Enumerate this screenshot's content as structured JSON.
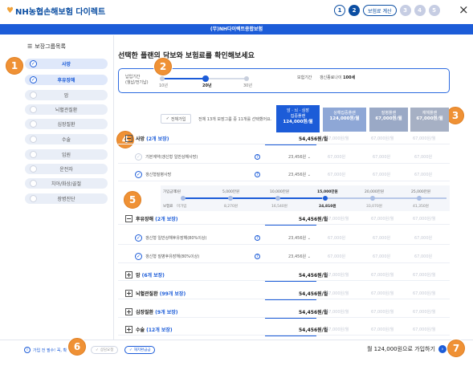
{
  "header": {
    "logo_text": "NH농협손해보험 다이렉트",
    "steps": [
      "1",
      "2",
      "3",
      "4",
      "5"
    ],
    "step_current_label": "보험료 계산",
    "close_symbol": "×",
    "bar_title": "(무)NH다이렉트종합보험"
  },
  "sidebar": {
    "title": "보장그룹목록",
    "items": [
      {
        "label": "사망",
        "checked": true
      },
      {
        "label": "후유장해",
        "checked": true
      },
      {
        "label": "암",
        "checked": false
      },
      {
        "label": "뇌혈관질환",
        "checked": false
      },
      {
        "label": "심장질환",
        "checked": false
      },
      {
        "label": "수술",
        "checked": false
      },
      {
        "label": "입원",
        "checked": false
      },
      {
        "label": "운전자",
        "checked": false
      },
      {
        "label": "치아/화상/골절",
        "checked": false
      },
      {
        "label": "장병진단",
        "checked": false
      }
    ]
  },
  "main": {
    "title": "선택한 플랜의 담보와 보험료를 확인해보세요",
    "period": {
      "label_line1": "납입기간",
      "label_line2": "(월납/전기납)",
      "ticks": [
        "10년",
        "20년",
        "30년"
      ],
      "selected_index": 1,
      "right_label": "보험기간",
      "right_value_prefix": "갱신종료나이 ",
      "right_value_bold": "100세"
    },
    "all_button": "전체가입",
    "select_info": "전체 13개 보장그룹 중 11개를 선택했어요.",
    "plans": [
      {
        "name_line1": "암 · 뇌 · 심장",
        "name_line2": "집중플랜",
        "price": "124,000원/월"
      },
      {
        "name_line1": "상해집중플랜",
        "name_line2": "",
        "price": "124,000원/월"
      },
      {
        "name_line1": "질병플랜",
        "name_line2": "",
        "price": "67,000원/월"
      },
      {
        "name_line1": "재해플랜",
        "name_line2": "",
        "price": "67,000원/월"
      }
    ]
  },
  "sections": {
    "death": {
      "title": "사망 ",
      "count": "(2개 보장)",
      "price": "54,456원/월",
      "others": [
        "67,000원/월",
        "67,000원/월",
        "67,000원/월"
      ]
    },
    "death_sub1": {
      "label": "기본계약(갱신형 일반상해사망)",
      "value": "23,456원",
      "others": [
        "67,000원",
        "67,000원",
        "67,000원"
      ]
    },
    "death_sub2": {
      "label": "갱신형질병사망",
      "value": "23,456원",
      "others": [
        "67,000원",
        "67,000원",
        "67,000원"
      ]
    },
    "slider": {
      "top_label": "가입금액",
      "bot_label": "보험료",
      "tops": [
        "0원",
        "5,000만원",
        "10,000만원",
        "15,000만원",
        "20,000만원",
        "25,000만원"
      ],
      "bots": [
        "미가입",
        "8,270원",
        "16,540원",
        "24,810원",
        "33,070원",
        "41,350원"
      ],
      "selected_index": 3
    },
    "disability": {
      "title": "후유장해 ",
      "count": "(2개 보장)",
      "price": "54,456원/월",
      "others": [
        "67,000원/월",
        "67,000원/월",
        "67,000원/월"
      ]
    },
    "dis_sub1": {
      "label": "갱신형 일반상해후유장해(80%이상)",
      "value": "23,456원",
      "others": [
        "67,000원",
        "67,000원",
        "67,000원"
      ]
    },
    "dis_sub2": {
      "label": "갱신형 질병후유장해(80%이상)",
      "value": "23,456원",
      "others": [
        "67,000원",
        "67,000원",
        "67,000원"
      ]
    },
    "cancer": {
      "title": "암 ",
      "count": "(6개 보장)",
      "price": "54,456원/월",
      "others": [
        "67,000원/월",
        "67,000원/월",
        "67,000원/월"
      ]
    },
    "brain": {
      "title": "뇌혈관질환 ",
      "count": "(99개 보장)",
      "price": "54,456원/월",
      "others": [
        "67,000원/월",
        "67,000원/월",
        "67,000원/월"
      ]
    },
    "heart": {
      "title": "심장질환 ",
      "count": "(9개 보장)",
      "price": "54,456원/월",
      "others": [
        "67,000원/월",
        "67,000원/월",
        "67,000원/월"
      ]
    },
    "surgery": {
      "title": "수술 ",
      "count": "(12개 보장)",
      "price": "54,456원/월",
      "others": [
        "67,000원/월",
        "67,000원/월",
        "67,000원/월"
      ]
    }
  },
  "footer": {
    "left_text": "가입 전 필수! 꼭, 확",
    "btn1": "상담요청",
    "btn2": "해지환급금",
    "right_text": "월 124,000원으로 가입하기"
  },
  "badges": [
    "1",
    "2",
    "3",
    "4",
    "5",
    "6",
    "7"
  ],
  "colors": {
    "accent": "#1c5cd8",
    "badge": "#ef9135"
  }
}
